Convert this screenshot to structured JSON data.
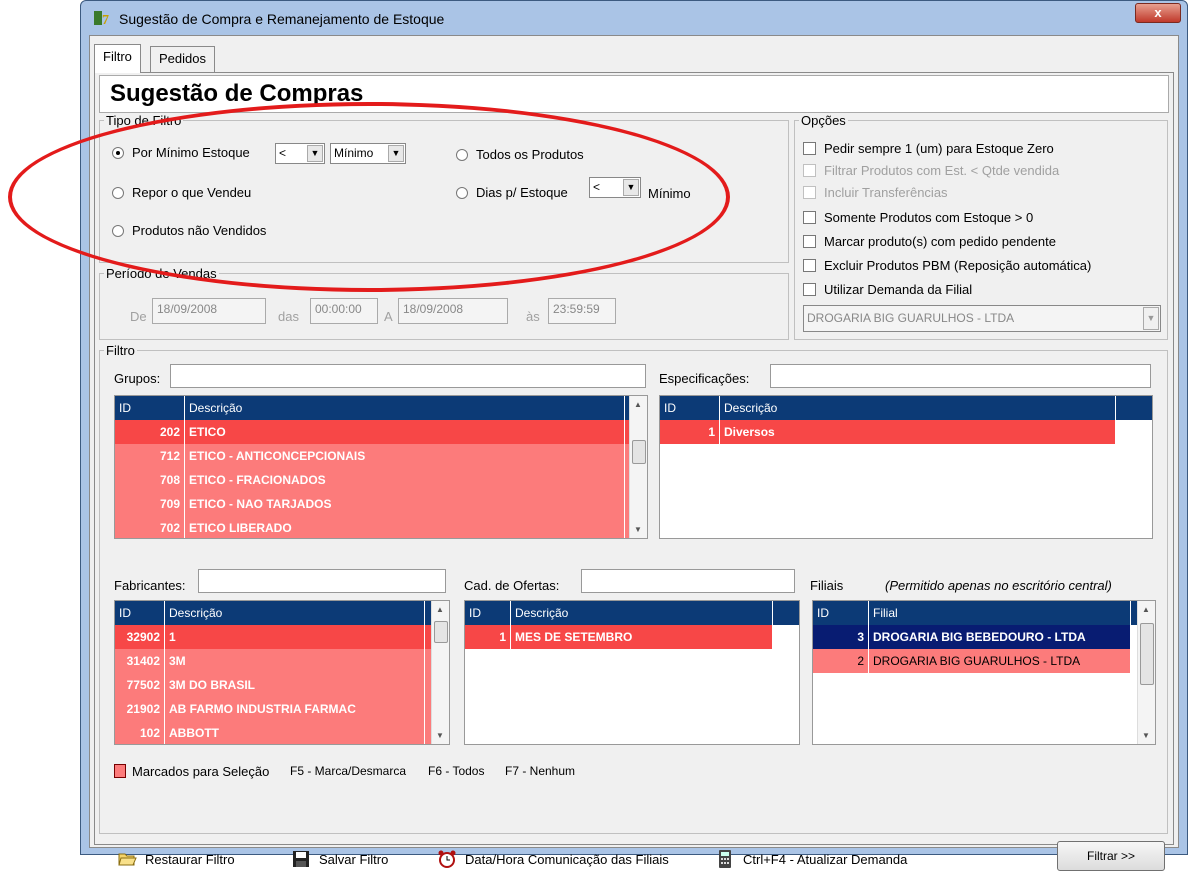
{
  "window": {
    "title": "Sugestão de Compra e Remanejamento de Estoque",
    "close": "x"
  },
  "tabs": [
    {
      "label": "Filtro"
    },
    {
      "label": "Pedidos"
    }
  ],
  "header": "Sugestão de Compras",
  "tipo_filtro": {
    "title": "Tipo de Filtro",
    "r1": "Por Mínimo Estoque",
    "r1_op": "<",
    "r1_mode": "Mínimo",
    "r2": "Repor o que Vendeu",
    "r3": "Produtos não Vendidos",
    "r4": "Todos os Produtos",
    "r5": "Dias p/ Estoque",
    "r5_op": "<",
    "r5_suffix": "Mínimo"
  },
  "opcoes": {
    "title": "Opções",
    "items": [
      "Pedir sempre 1 (um) para Estoque Zero",
      "Filtrar Produtos com Est. < Qtde vendida",
      "Incluir Transferências",
      "Somente Produtos com Estoque > 0",
      "Marcar produto(s) com pedido pendente",
      "Excluir Produtos PBM (Reposição automática)",
      "Utilizar Demanda da Filial"
    ],
    "filial": "DROGARIA BIG GUARULHOS - LTDA"
  },
  "periodo": {
    "title": "Período de Vendas",
    "de": "De",
    "de_date": "18/09/2008",
    "das": "das",
    "de_time": "00:00:00",
    "a": "A",
    "a_date": "18/09/2008",
    "as": "às",
    "a_time": "23:59:59"
  },
  "filtro": {
    "title": "Filtro",
    "grupos_label": "Grupos:",
    "espec_label": "Especificações:",
    "fab_label": "Fabricantes:",
    "ofertas_label": "Cad. de Ofertas:",
    "filiais_label": "Filiais",
    "filiais_note": "(Permitido apenas no escritório central)",
    "col_id": "ID",
    "col_desc": "Descrição",
    "col_filial": "Filial",
    "grupos": [
      [
        "202",
        "ETICO"
      ],
      [
        "712",
        "ETICO - ANTICONCEPCIONAIS"
      ],
      [
        "708",
        "ETICO - FRACIONADOS"
      ],
      [
        "709",
        "ETICO - NAO TARJADOS"
      ],
      [
        "702",
        "ETICO LIBERADO"
      ]
    ],
    "espec": [
      [
        "1",
        "Diversos"
      ]
    ],
    "fabricantes": [
      [
        "32902",
        "1"
      ],
      [
        "31402",
        "3M"
      ],
      [
        "77502",
        "3M DO BRASIL"
      ],
      [
        "21902",
        "AB FARMO INDUSTRIA FARMAC"
      ],
      [
        "102",
        "ABBOTT"
      ]
    ],
    "ofertas": [
      [
        "1",
        "MES DE SETEMBRO"
      ]
    ],
    "filiais": [
      [
        "3",
        "DROGARIA BIG BEBEDOURO - LTDA"
      ],
      [
        "2",
        "DROGARIA BIG GUARULHOS - LTDA"
      ]
    ]
  },
  "legend": {
    "text": "Marcados para Seleção",
    "k1": "F5 - Marca/Desmarca",
    "k2": "F6 - Todos",
    "k3": "F7 - Nenhum"
  },
  "toolbar": {
    "restaurar": "Restaurar Filtro",
    "salvar": "Salvar Filtro",
    "data_hora": "Data/Hora Comunicação das Filiais",
    "atualizar": "Ctrl+F4 - Atualizar Demanda",
    "filtrar": "Filtrar >>"
  },
  "colors": {
    "selected_row": "#f74747",
    "marked_row": "#fc7b7b",
    "highlight_row": "#081c72",
    "list_header": "#0c3a76",
    "annotation": "#e31b1b"
  }
}
